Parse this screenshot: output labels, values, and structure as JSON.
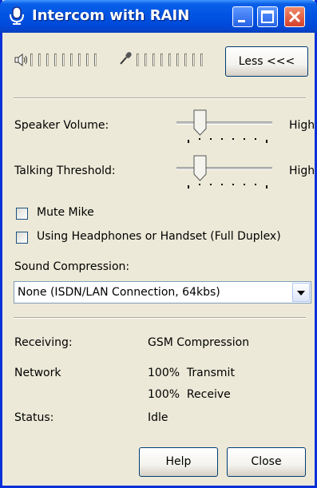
{
  "window": {
    "title": "Intercom with RAIN"
  },
  "toolbar": {
    "less_button": "Less <<<",
    "speaker_meter_level": 0,
    "mic_meter_level": 0
  },
  "speaker_volume": {
    "label": "Speaker Volume:",
    "high_label": "High",
    "level": 0.25
  },
  "talking_threshold": {
    "label": "Talking Threshold:",
    "high_label": "High",
    "level": 0.25
  },
  "options": {
    "mute_mike": {
      "label": "Mute Mike",
      "checked": false
    },
    "headphones": {
      "label": "Using Headphones or Handset (Full Duplex)",
      "checked": false
    }
  },
  "compression": {
    "label": "Sound Compression:",
    "selected": "None (ISDN/LAN Connection, 64kbs)"
  },
  "info": {
    "receiving_label": "Receiving:",
    "receiving_value": "GSM Compression",
    "network_label": "Network",
    "network_transmit": "100%  Transmit",
    "network_receive": "100%  Receive",
    "status_label": "Status:",
    "status_value": "Idle"
  },
  "buttons": {
    "help": "Help",
    "close": "Close"
  }
}
